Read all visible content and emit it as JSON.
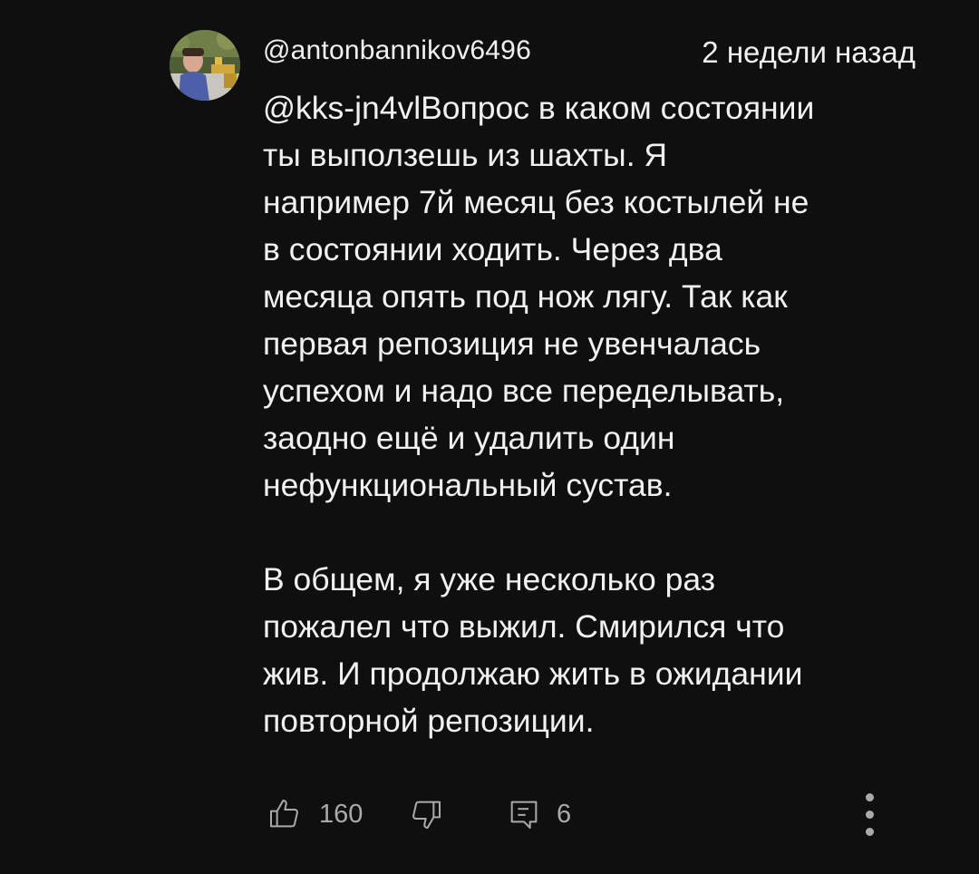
{
  "comment": {
    "author": "@antonbannikov6496",
    "timestamp": "2 недели назад",
    "paragraphs": [
      "@kks-jn4vlВопрос в каком состоянии\nты выползешь из шахты. Я\nнапример 7й месяц без костылей не\nв состоянии ходить. Через два\nмесяца опять под нож лягу. Так как\nпервая репозиция не увенчалась\nуспехом и надо все переделывать,\nзаодно ещё и удалить один\nнефункциональный сустав.",
      "В общем, я уже несколько раз\nпожалел что выжил. Смирился что\nжив. И продолжаю жить в ожидании\nповторной репозиции."
    ],
    "like_count": "160",
    "reply_count": "6"
  },
  "icons": {
    "like": "thumbs-up-icon",
    "dislike": "thumbs-down-icon",
    "reply": "reply-comment-icon",
    "more": "more-vertical-icon"
  },
  "colors": {
    "background": "#0f0f0f",
    "text": "#f1f1f1",
    "secondary": "#aaaaaa"
  }
}
